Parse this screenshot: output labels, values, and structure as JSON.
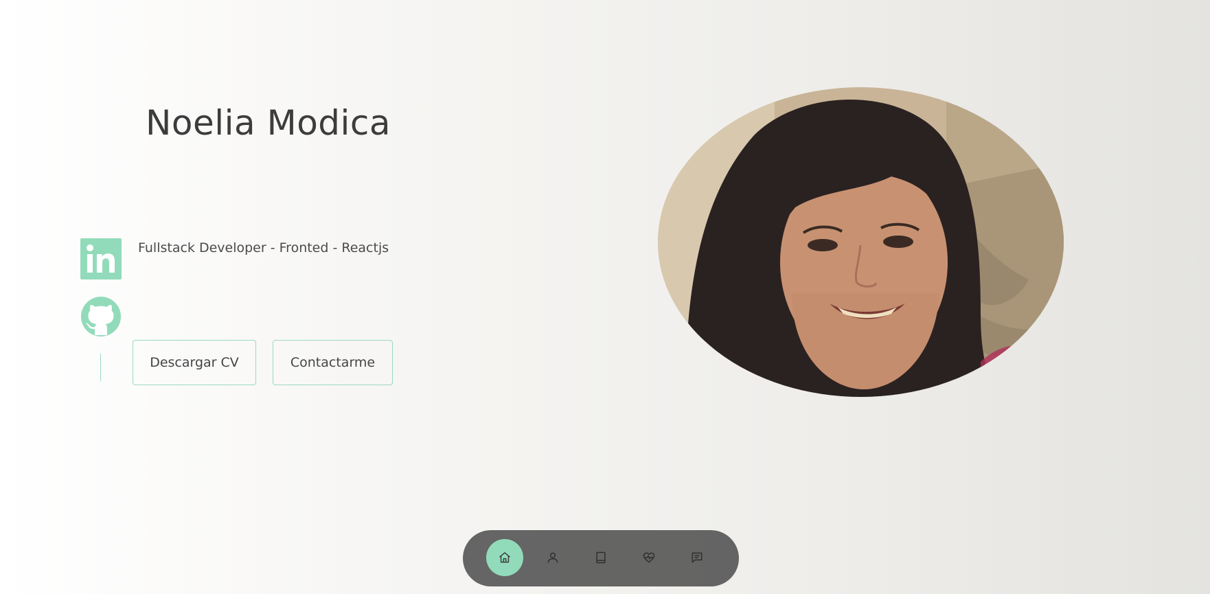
{
  "hero": {
    "name": "Noelia Modica",
    "role": "Fullstack Developer - Fronted - Reactjs"
  },
  "buttons": {
    "download_cv": "Descargar CV",
    "contact": "Contactarme"
  },
  "socials": [
    {
      "icon": "linkedin-icon"
    },
    {
      "icon": "github-icon"
    }
  ],
  "nav": {
    "items": [
      {
        "icon": "home-icon",
        "active": true
      },
      {
        "icon": "user-icon",
        "active": false
      },
      {
        "icon": "book-icon",
        "active": false
      },
      {
        "icon": "heart-pulse-icon",
        "active": false
      },
      {
        "icon": "message-icon",
        "active": false
      }
    ]
  },
  "colors": {
    "accent": "#92dbba",
    "accent_border": "#9bd9bf",
    "nav_bg": "#4a4a4a",
    "text": "#444444"
  }
}
